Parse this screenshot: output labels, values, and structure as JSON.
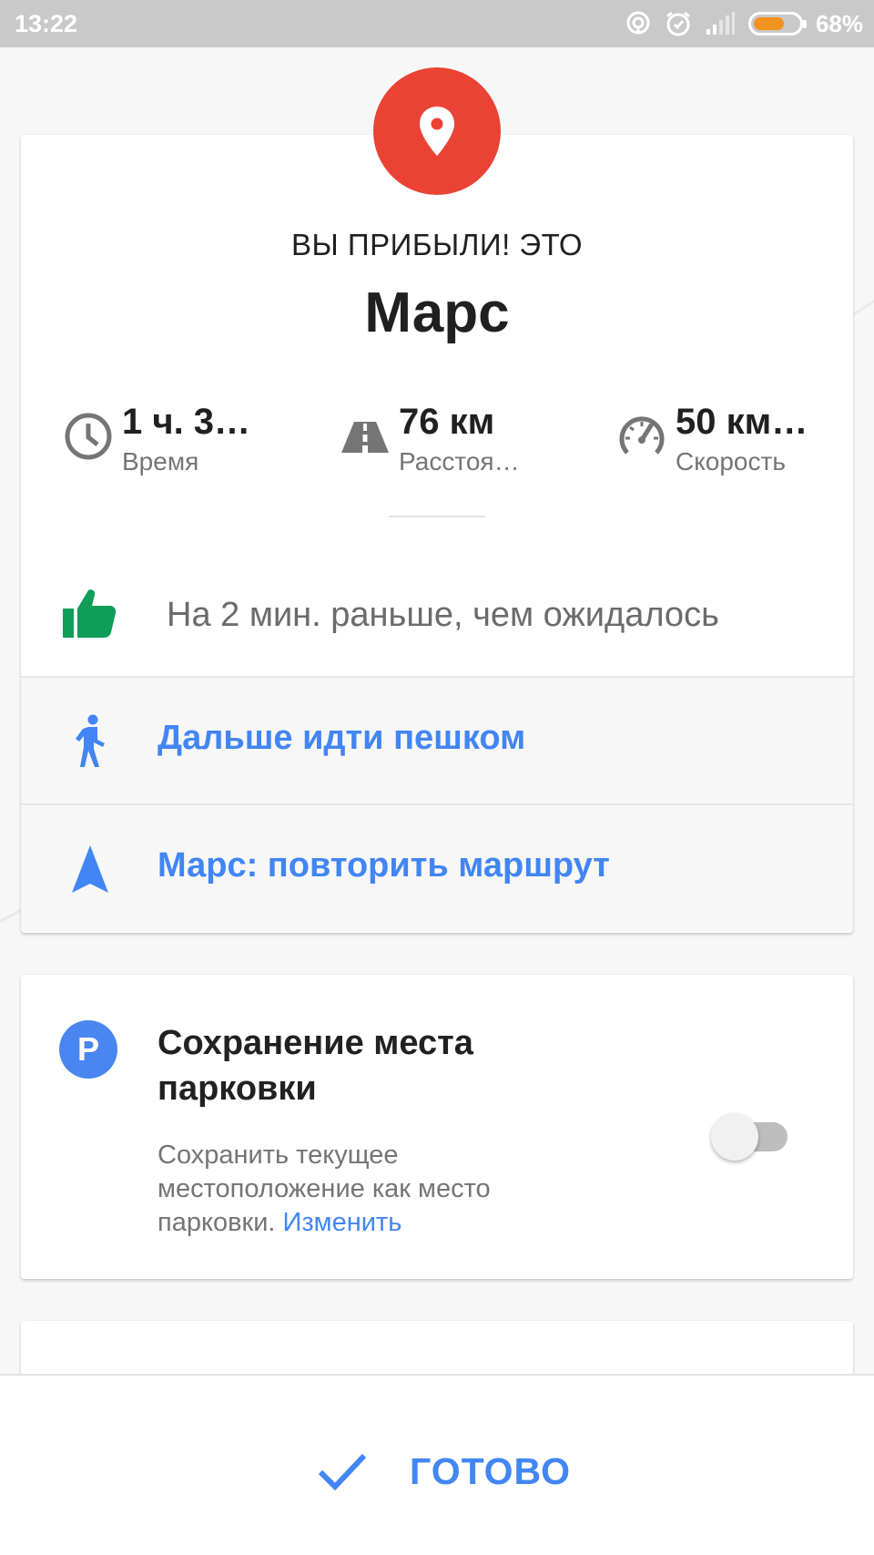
{
  "status_bar": {
    "time": "13:22",
    "battery_percent": "68%",
    "battery_level": 0.68,
    "icons": [
      "hotspot-icon",
      "alarm-icon",
      "signal-icon",
      "battery-icon"
    ]
  },
  "arrival": {
    "header": "ВЫ ПРИБЫЛИ! ЭТО",
    "place": "Марс",
    "stats": [
      {
        "value": "1 ч. 3…",
        "label": "Время",
        "icon": "clock-icon"
      },
      {
        "value": "76 км",
        "label": "Расстоя…",
        "icon": "road-icon"
      },
      {
        "value": "50 км…",
        "label": "Скорость",
        "icon": "speedometer-icon"
      }
    ],
    "early_message": "На 2 мин. раньше, чем ожидалось",
    "actions": [
      {
        "label": "Дальше идти пешком",
        "icon": "walking-icon"
      },
      {
        "label": "Марс: повторить маршрут",
        "icon": "navigation-arrow-icon"
      }
    ]
  },
  "parking": {
    "badge": "P",
    "title": "Сохранение места парковки",
    "description": "Сохранить текущее местоположение как место парковки.",
    "link": "Изменить",
    "toggle_on": false
  },
  "footer": {
    "done_label": "ГОТОВО"
  },
  "colors": {
    "accent": "#4285f4",
    "pin": "#ea4335",
    "thumb": "#0f9d58",
    "battery": "#f39221"
  }
}
